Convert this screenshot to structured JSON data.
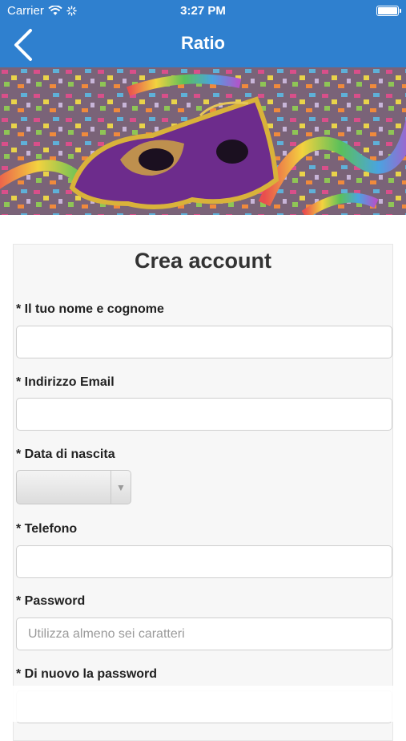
{
  "status": {
    "carrier": "Carrier",
    "time": "3:27 PM"
  },
  "nav": {
    "title": "Ratio"
  },
  "form": {
    "title": "Crea account",
    "fields": [
      {
        "label": "* Il tuo nome e cognome",
        "value": "",
        "placeholder": ""
      },
      {
        "label": "* Indirizzo Email",
        "value": "",
        "placeholder": ""
      },
      {
        "label": "* Data di nascita",
        "value": ""
      },
      {
        "label": "* Telefono",
        "value": "",
        "placeholder": ""
      },
      {
        "label": "* Password",
        "value": "",
        "placeholder": "Utilizza almeno sei caratteri"
      },
      {
        "label": "* Di nuovo la password",
        "value": "",
        "placeholder": ""
      }
    ]
  },
  "colors": {
    "nav": "#2f80cf",
    "card": "#f7f7f7"
  }
}
